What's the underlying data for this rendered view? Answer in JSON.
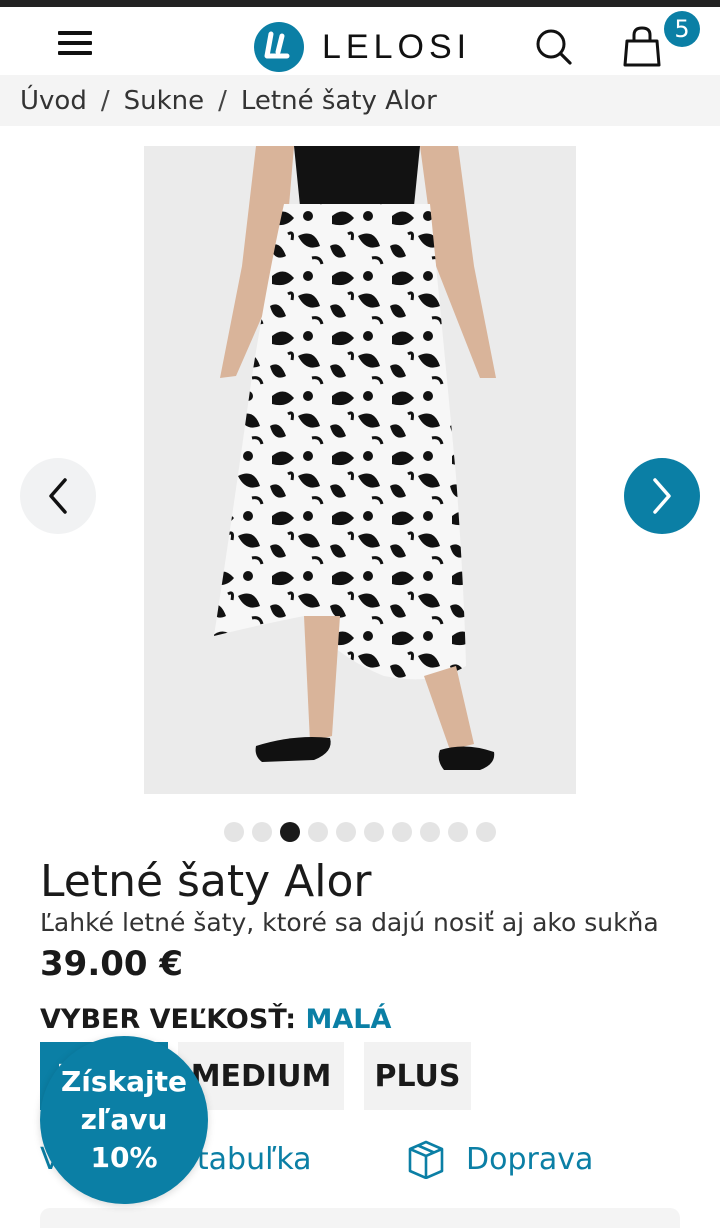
{
  "header": {
    "logo_text": "LELOSI",
    "cart_count": "5"
  },
  "breadcrumb": {
    "items": [
      "Úvod",
      "Sukne",
      "Letné šaty Alor"
    ],
    "separator": "/"
  },
  "gallery": {
    "image_alt": "Sukňa s čiernobielym kvetinovým vzorom",
    "total_slides": 10,
    "active_slide": 3
  },
  "product": {
    "title": "Letné šaty Alor",
    "subtitle": "Ľahké letné šaty, ktoré sa dajú nosiť aj ako sukňa",
    "price": "39.00 €"
  },
  "size_picker": {
    "label": "VYBER VEĽKOSŤ:",
    "selected": "MALÁ",
    "options": [
      "MALÁ",
      "MEDIUM",
      "PLUS"
    ]
  },
  "links": {
    "size_table": "Veľkostná tabuľka",
    "shipping": "Doprava"
  },
  "promo": {
    "line1": "Získajte",
    "line2": "zľavu",
    "line3": "10%"
  },
  "colors": {
    "accent": "#0b7fa5",
    "dark": "#1a1a1a",
    "light_bg": "#f4f4f4"
  }
}
